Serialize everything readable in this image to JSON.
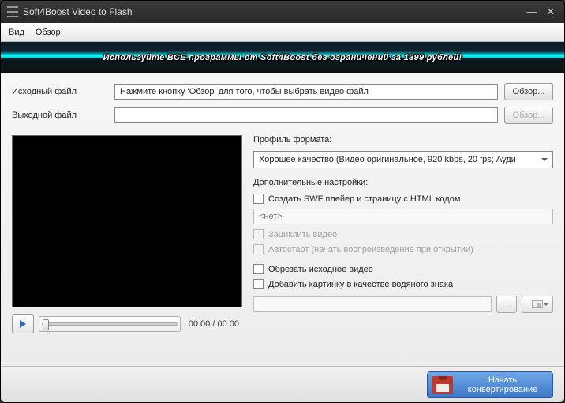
{
  "window": {
    "title": "Soft4Boost Video to Flash"
  },
  "menu": {
    "view": "Вид",
    "browse": "Обзор"
  },
  "banner": {
    "text": "Используйте ВСЕ программы от Soft4Boost без ограничений за 1399 рублей!"
  },
  "files": {
    "input_label": "Исходный файл",
    "input_value": "Нажмите кнопку 'Обзор' для того, чтобы выбрать видео файл",
    "output_label": "Выходной файл",
    "output_value": "",
    "browse": "Обзор..."
  },
  "player": {
    "time": "00:00 / 00:00"
  },
  "settings": {
    "profile_label": "Профиль формата:",
    "profile_value": "Хорошее качество (Видео оригинальное, 920 kbps, 20 fps; Ауди",
    "extra_label": "Дополнительные настройки:",
    "chk_swf": "Создать SWF плейер и страницу с HTML кодом",
    "swf_path_placeholder": "<нет>",
    "chk_loop": "Зациклить видео",
    "chk_autostart": "Автостарт (начать воспроизведение при открытии)",
    "chk_crop": "Обрезать исходное видео",
    "chk_watermark": "Добавить картинку в качестве водяного знака"
  },
  "footer": {
    "convert": "Начать конвертирование"
  }
}
